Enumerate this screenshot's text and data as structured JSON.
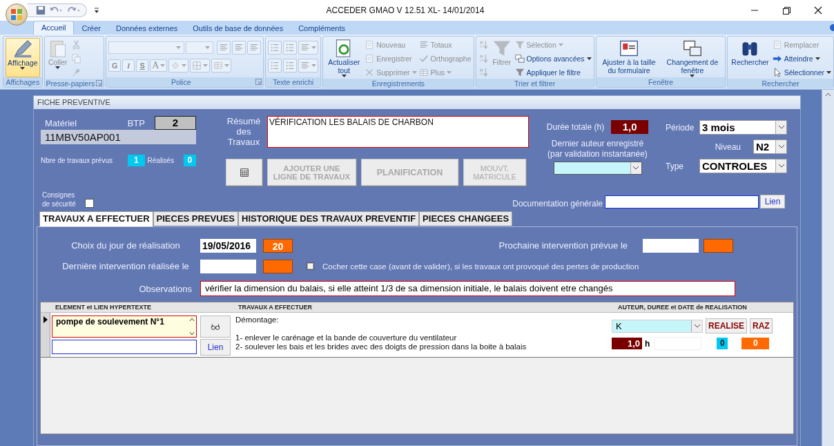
{
  "window": {
    "title": "ACCEDER GMAO V 12.51  XL- 14/01/2014"
  },
  "ribbon": {
    "tabs": [
      {
        "label": "Accueil",
        "selected": true
      },
      {
        "label": "Créer",
        "selected": false
      },
      {
        "label": "Données externes",
        "selected": false
      },
      {
        "label": "Outils de base de données",
        "selected": false
      },
      {
        "label": "Compléments",
        "selected": false
      }
    ],
    "groups": [
      {
        "label": "Affichages",
        "launcher": false,
        "columns": [
          [
            {
              "kind": "large",
              "label": "Affichage",
              "disabled": false,
              "dropdown": true,
              "selected": true
            }
          ]
        ]
      },
      {
        "label": "Presse-papiers",
        "launcher": true,
        "columns": [
          [
            {
              "kind": "large",
              "label": "Coller",
              "disabled": true,
              "dropdown": true,
              "selected": false
            }
          ],
          [
            {
              "kind": "icon",
              "disabled": true,
              "dropdown": false
            },
            {
              "kind": "icon",
              "disabled": true,
              "dropdown": false
            },
            {
              "kind": "icon",
              "disabled": true,
              "dropdown": false
            }
          ]
        ]
      },
      {
        "label": "Police",
        "launcher": true,
        "rows": [
          [
            {
              "kind": "combo",
              "disabled": true
            },
            {
              "kind": "combo",
              "disabled": true
            },
            {
              "kind": "icon",
              "disabled": true,
              "dropdown": false
            },
            {
              "kind": "icon",
              "disabled": true,
              "dropdown": false
            },
            {
              "kind": "icon",
              "disabled": true,
              "dropdown": false
            }
          ],
          [
            {
              "kind": "letter",
              "label": "G",
              "disabled": true,
              "dropdown": false
            },
            {
              "kind": "letter",
              "label": "I",
              "disabled": true,
              "dropdown": false
            },
            {
              "kind": "letter",
              "label": "S",
              "disabled": true,
              "dropdown": false
            },
            {
              "kind": "letter",
              "label": "A",
              "disabled": true,
              "dropdown": true
            },
            {
              "kind": "icon",
              "disabled": true,
              "dropdown": true
            },
            {
              "kind": "icon",
              "disabled": true,
              "dropdown": true
            },
            {
              "kind": "icon",
              "disabled": true,
              "dropdown": true
            }
          ]
        ]
      },
      {
        "label": "Texte enrichi",
        "launcher": false,
        "rows": [
          [
            {
              "kind": "icon",
              "disabled": true,
              "dropdown": false
            },
            {
              "kind": "icon",
              "disabled": true,
              "dropdown": false
            },
            {
              "kind": "icon",
              "disabled": true,
              "dropdown": true
            }
          ],
          [
            {
              "kind": "icon",
              "disabled": true,
              "dropdown": false
            },
            {
              "kind": "icon",
              "disabled": true,
              "dropdown": false
            },
            {
              "kind": "icon",
              "disabled": true,
              "dropdown": true
            }
          ]
        ]
      },
      {
        "label": "Enregistrements",
        "launcher": false,
        "columns": [
          [
            {
              "kind": "large",
              "label": "Actualiser tout",
              "disabled": false,
              "dropdown": true,
              "selected": false
            }
          ],
          [
            {
              "kind": "small",
              "label": "Nouveau",
              "disabled": true,
              "dropdown": false
            },
            {
              "kind": "small",
              "label": "Enregistrer",
              "disabled": true,
              "dropdown": false
            },
            {
              "kind": "small",
              "label": "Supprimer",
              "disabled": true,
              "dropdown": true
            }
          ],
          [
            {
              "kind": "small",
              "label": "Totaux",
              "disabled": true,
              "dropdown": false
            },
            {
              "kind": "small",
              "label": "Orthographe",
              "disabled": true,
              "dropdown": false
            },
            {
              "kind": "small",
              "label": "Plus",
              "disabled": true,
              "dropdown": true
            }
          ]
        ]
      },
      {
        "label": "Trier et filtrer",
        "launcher": false,
        "columns": [
          [
            {
              "kind": "icon",
              "disabled": true,
              "dropdown": false
            },
            {
              "kind": "icon",
              "disabled": true,
              "dropdown": false
            },
            {
              "kind": "icon",
              "disabled": true,
              "dropdown": false
            }
          ],
          [
            {
              "kind": "large",
              "label": "Filtrer",
              "disabled": true,
              "dropdown": false,
              "selected": false
            }
          ],
          [
            {
              "kind": "small",
              "label": "Sélection",
              "disabled": true,
              "dropdown": true
            },
            {
              "kind": "small",
              "label": "Options avancées",
              "disabled": false,
              "dropdown": true
            },
            {
              "kind": "small",
              "label": "Appliquer le filtre",
              "disabled": false,
              "dropdown": false
            }
          ]
        ]
      },
      {
        "label": "Fenêtre",
        "launcher": false,
        "columns": [
          [
            {
              "kind": "large",
              "label": "Ajuster à la taille du formulaire",
              "disabled": false,
              "dropdown": false,
              "selected": false
            }
          ],
          [
            {
              "kind": "large",
              "label": "Changement de fenêtre",
              "disabled": false,
              "dropdown": true,
              "selected": false
            }
          ]
        ]
      },
      {
        "label": "Rechercher",
        "launcher": false,
        "columns": [
          [
            {
              "kind": "large",
              "label": "Rechercher",
              "disabled": false,
              "dropdown": false,
              "selected": false
            }
          ],
          [
            {
              "kind": "small",
              "label": "Remplacer",
              "disabled": true,
              "dropdown": false
            },
            {
              "kind": "small",
              "label": "Atteindre",
              "disabled": false,
              "dropdown": true
            },
            {
              "kind": "small",
              "label": "Sélectionner",
              "disabled": false,
              "dropdown": true
            }
          ]
        ]
      }
    ]
  },
  "form": {
    "title": "FICHE PREVENTIVE",
    "materiel": {
      "label": "Matériel",
      "value": "11MBV50AP001"
    },
    "btp": {
      "label": "BTP",
      "value": "2"
    },
    "counts": {
      "planned_label": "Nbre de travaux prévus",
      "planned": "1",
      "done_label": "Réalisés",
      "done": "0"
    },
    "safety": {
      "label": "Consignes de sécurité",
      "checked": false
    },
    "summary": {
      "label": "Résumé des Travaux",
      "value": "VÉRIFICATION LES BALAIS DE CHARBON"
    },
    "actions": [
      {
        "kind": "calendar",
        "disabled": false
      },
      {
        "kind": "text",
        "label": "AJOUTER  UNE LIGNE DE TRAVAUX",
        "disabled": true
      },
      {
        "kind": "text",
        "label": "PLANIFICATION",
        "disabled": true
      },
      {
        "kind": "text",
        "label": "MOUVT. MATRICULE",
        "disabled": true
      }
    ],
    "duration": {
      "label": "Durée totale (h)",
      "value": "1,0"
    },
    "last_author": {
      "label": "Dernier auteur enregistré (par validation instantanée)"
    },
    "period": {
      "label": "Période",
      "value": "3 mois"
    },
    "level": {
      "label": "Niveau",
      "value": "N2"
    },
    "type": {
      "label": "Type",
      "value": "CONTROLES"
    },
    "documentation": {
      "label": "Documentation générale",
      "button": "Lien"
    },
    "tabs": [
      {
        "label": "TRAVAUX  A EFFECTUER",
        "selected": true
      },
      {
        "label": "PIECES PREVUES",
        "selected": false
      },
      {
        "label": "HISTORIQUE DES TRAVAUX PREVENTIF",
        "selected": false
      },
      {
        "label": "PIECES CHANGEES",
        "selected": false
      }
    ],
    "schedule": {
      "choice_label": "Choix du jour de réalisation",
      "choice_date": "19/05/2016",
      "choice_day": "20",
      "next_label": "Prochaine intervention prévue le",
      "last_label": "Dernière intervention réalisée le",
      "loss": {
        "label": "Cocher cette case (avant de valider), si les travaux ont provoqué des pertes de production",
        "checked": false
      }
    },
    "observations": {
      "label": "Observations",
      "value": "vérifier la dimension du balais, si elle atteint 1/3 de sa dimension initiale, le balais doivent etre changés"
    },
    "table": {
      "columns": [
        "ELEMENT et LIEN HYPERTEXTE",
        "TRAVAUX A EFFECTUER",
        "AUTEUR, DUREE et DATE de REALISATION"
      ],
      "rows": [
        {
          "selected": true,
          "element": "pompe de soulevement N°1",
          "link_button": "Lien",
          "work": "Démontage:\n\n1- enlever le carénage et la bande de couverture du ventilateur\n2- soulever les bais et les brides avec des doigts de pression dans la boite à balais",
          "author": "K",
          "realise": "REALISE",
          "reset": "RAZ",
          "duration": "1,0",
          "unit": "h",
          "count_a": "0",
          "count_b": "0"
        }
      ]
    }
  }
}
